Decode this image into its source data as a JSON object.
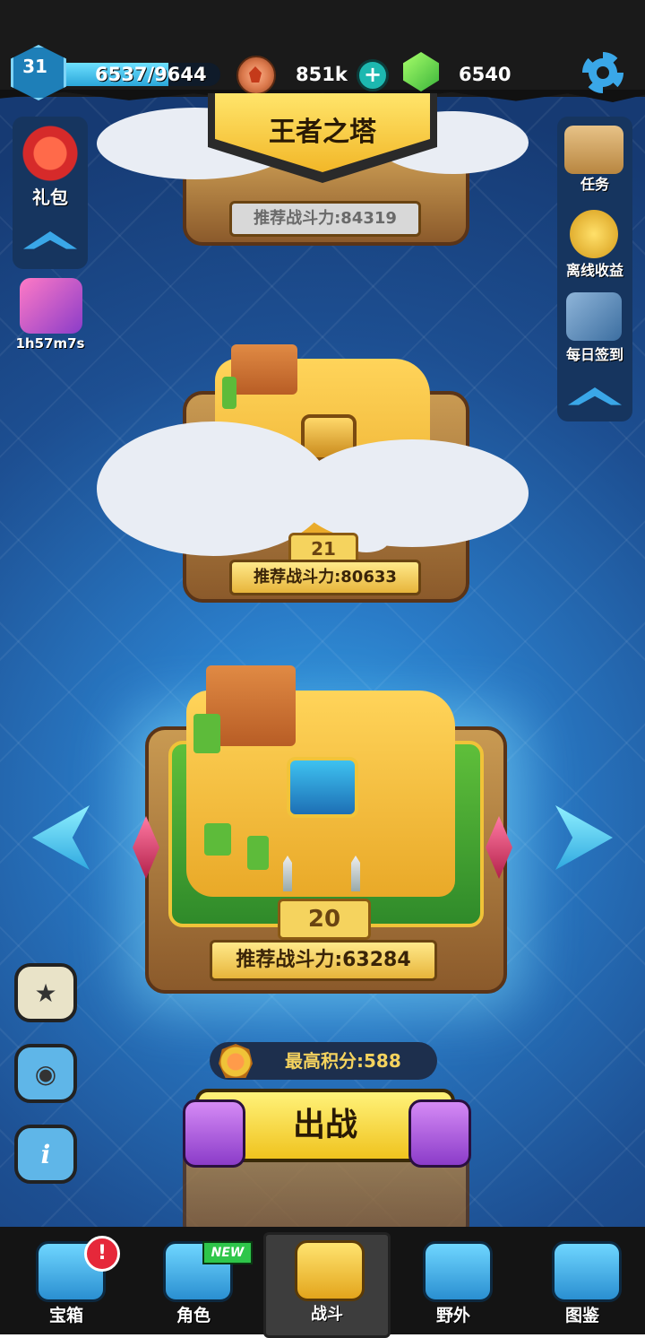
{
  "player": {
    "level": "31",
    "xp_text": "6537/9644",
    "xp_fraction": 0.678
  },
  "currency": {
    "coins": "851k",
    "gems": "6540"
  },
  "title": "王者之塔",
  "stages": {
    "top": {
      "power": "推荐战斗力:84319"
    },
    "middle": {
      "level": "21",
      "power": "推荐战斗力:80633"
    },
    "current": {
      "level": "20",
      "power": "推荐战斗力:63284"
    }
  },
  "left_panel": {
    "gift_label": "礼包",
    "timer": "1h57m7s"
  },
  "right_panel": {
    "task_label": "任务",
    "offline_label": "离线收益",
    "daily_label": "每日签到"
  },
  "score": {
    "best": "最高积分:588"
  },
  "fight_button": "出战",
  "nav": {
    "chest": "宝箱",
    "character": "角色",
    "battle": "战斗",
    "field": "野外",
    "codex": "图鉴",
    "alert_badge": "!",
    "new_badge": "NEW"
  }
}
